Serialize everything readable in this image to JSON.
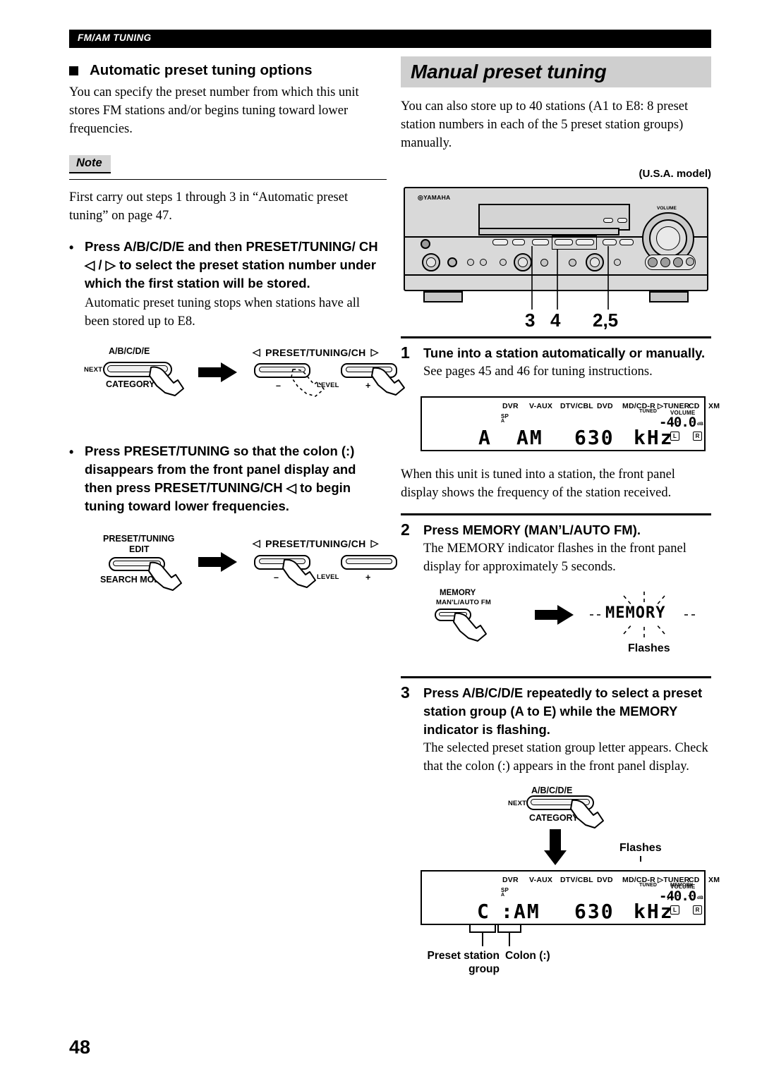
{
  "header": {
    "running_head": "FM/AM TUNING"
  },
  "page": {
    "number": "48"
  },
  "left": {
    "section_heading": "Automatic preset tuning options",
    "intro": "You can specify the preset number from which this unit stores FM stations and/or begins tuning toward lower frequencies.",
    "note_label": "Note",
    "note_text": "First carry out steps 1 through 3 in “Automatic preset tuning” on page 47.",
    "bullets": [
      {
        "marker": "•",
        "title": "Press A/B/C/D/E and then PRESET/TUNING/ CH ◁ / ▷ to select the preset station number under which the first station will be stored.",
        "body": "Automatic preset tuning stops when stations have all been stored up to E8."
      },
      {
        "marker": "•",
        "title": "Press PRESET/TUNING so that the colon (:) disappears from the front panel display and then press PRESET/TUNING/CH ◁ to begin tuning toward lower frequencies.",
        "body": ""
      }
    ],
    "diagram1": {
      "button_top_label": "A/B/C/D/E",
      "button_left_label": "NEXT",
      "button_bottom_label": "CATEGORY",
      "right_label": "PRESET/TUNING/CH",
      "left_arrow": "◁",
      "right_arrow": "▷",
      "minus": "–",
      "plus": "+",
      "level": "LEVEL"
    },
    "diagram2": {
      "button_top_label_1": "PRESET/TUNING",
      "button_top_label_2": "EDIT",
      "button_bottom_label": "SEARCH MODE",
      "right_label": "PRESET/TUNING/CH",
      "left_arrow": "◁",
      "right_arrow": "▷",
      "minus": "–",
      "plus": "+",
      "level": "LEVEL"
    }
  },
  "right": {
    "banner_title": "Manual preset tuning",
    "intro": "You can also store up to 40 stations (A1 to E8: 8 preset station numbers in each of the 5 preset station groups) manually.",
    "model_label": "(U.S.A. model)",
    "receiver": {
      "brand": "YAMAHA",
      "volume_label": "VOLUME",
      "callouts": [
        "3",
        "4",
        "2,5"
      ]
    },
    "steps": [
      {
        "num": "1",
        "title": "Tune into a station automatically or manually.",
        "body": "See pages 45 and 46 for tuning instructions.",
        "after_body": "When this unit is tuned into a station, the front panel display shows the frequency of the station received."
      },
      {
        "num": "2",
        "title": "Press MEMORY (MAN’L/AUTO FM).",
        "body": "The MEMORY indicator flashes in the front panel display for approximately 5 seconds."
      },
      {
        "num": "3",
        "title": "Press A/B/C/D/E repeatedly to select a preset station group (A to E) while the MEMORY indicator is flashing.",
        "body": "The selected preset station group letter appears. Check that the colon (:) appears in the front panel display."
      }
    ],
    "lcd1": {
      "sources": [
        "DVR",
        "V-AUX",
        "DTV/CBL",
        "DVD",
        "MD/CD-R",
        "▷TUNER",
        "CD",
        "XM"
      ],
      "tuned": "TUNED",
      "sp": "SP",
      "sp_a": "A",
      "volume_label": "VOLUME",
      "volume_value": "-40.0",
      "volume_unit": "dB",
      "main_group": "A",
      "main_band": "AM",
      "main_freq": "630",
      "main_unit": "kHz",
      "ch_l": "L",
      "ch_r": "R"
    },
    "memory_diagram": {
      "button_label_1": "MEMORY",
      "button_label_2": "MAN'L/AUTO FM",
      "indicator": "MEMORY",
      "flashes": "Flashes"
    },
    "abcde_diagram": {
      "top_label": "A/B/C/D/E",
      "left_label": "NEXT",
      "bottom_label": "CATEGORY"
    },
    "lcd2": {
      "sources": [
        "DVR",
        "V-AUX",
        "DTV/CBL",
        "DVD",
        "MD/CD-R",
        "▷TUNER",
        "CD",
        "XM"
      ],
      "tuned": "TUNED",
      "memory": "MEMORY",
      "sp": "SP",
      "sp_a": "A",
      "volume_label": "VOLUME",
      "volume_value": "-40.0",
      "volume_unit": "dB",
      "main_group": "C",
      "main_colon": ":",
      "main_band": "AM",
      "main_freq": "630",
      "main_unit": "kHz",
      "ch_l": "L",
      "ch_r": "R",
      "flashes": "Flashes",
      "caption_group_1": "Preset station",
      "caption_group_2": "group",
      "caption_colon": "Colon (:)"
    }
  }
}
